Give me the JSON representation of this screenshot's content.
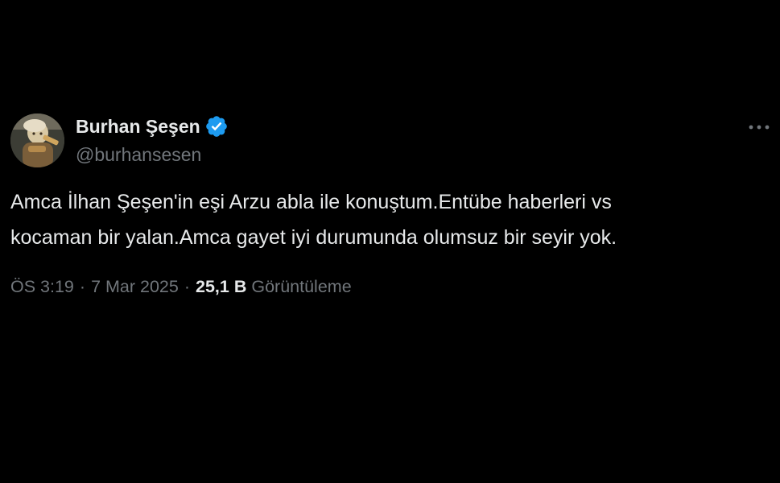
{
  "author": {
    "display_name": "Burhan Şeşen",
    "handle": "@burhansesen",
    "verified": true,
    "verified_badge_color": "#1d9bf0"
  },
  "tweet": {
    "text": "Amca İlhan Şeşen'in eşi Arzu abla ile konuştum.Entübe haberleri vs\nkocaman bir yalan.Amca gayet iyi durumunda olumsuz bir seyir yok."
  },
  "meta": {
    "time": "ÖS 3:19",
    "separator": "·",
    "date": "7 Mar 2025",
    "views_count": "25,1 B",
    "views_label": "Görüntüleme"
  },
  "icons": {
    "more": "more-options-icon",
    "verified": "verified-badge-icon"
  },
  "colors": {
    "background": "#000000",
    "primary_text": "#e7e9ea",
    "secondary_text": "#71767b"
  }
}
